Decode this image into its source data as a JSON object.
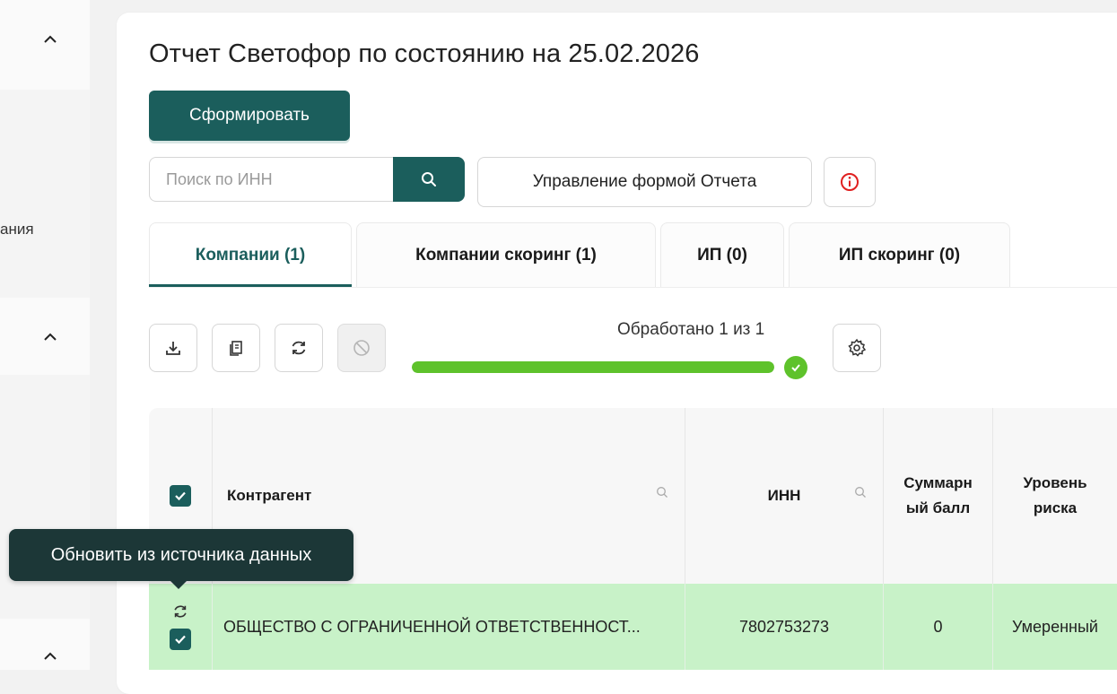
{
  "sidebar": {
    "partial_label": "ания"
  },
  "page": {
    "title": "Отчет Светофор по состоянию на 25.02.2026"
  },
  "toolbar": {
    "generate_label": "Сформировать",
    "search_placeholder": "Поиск по ИНН",
    "manage_form_label": "Управление формой Отчета"
  },
  "tabs": [
    {
      "label": "Компании (1)",
      "active": true
    },
    {
      "label": "Компании скоринг (1)",
      "active": false
    },
    {
      "label": "ИП (0)",
      "active": false
    },
    {
      "label": "ИП скоринг (0)",
      "active": false
    }
  ],
  "progress": {
    "label": "Обработано 1 из 1",
    "fraction": 1.0,
    "color": "#5ec22b"
  },
  "table": {
    "columns": {
      "counterparty": "Контрагент",
      "inn": "ИНН",
      "total_score": "Суммарн ый балл",
      "risk_level": "Уровень риска"
    },
    "rows": [
      {
        "counterparty": "ОБЩЕСТВО С ОГРАНИЧЕННОЙ ОТВЕТСТВЕННОСТ...",
        "inn": "7802753273",
        "total_score": "0",
        "risk_level": "Умеренный"
      }
    ]
  },
  "tooltip": {
    "text": "Обновить из источника данных"
  },
  "colors": {
    "primary": "#1b5e5c",
    "row_highlight": "#c8f2c8",
    "success": "#5ec22b",
    "info": "#e02020"
  }
}
